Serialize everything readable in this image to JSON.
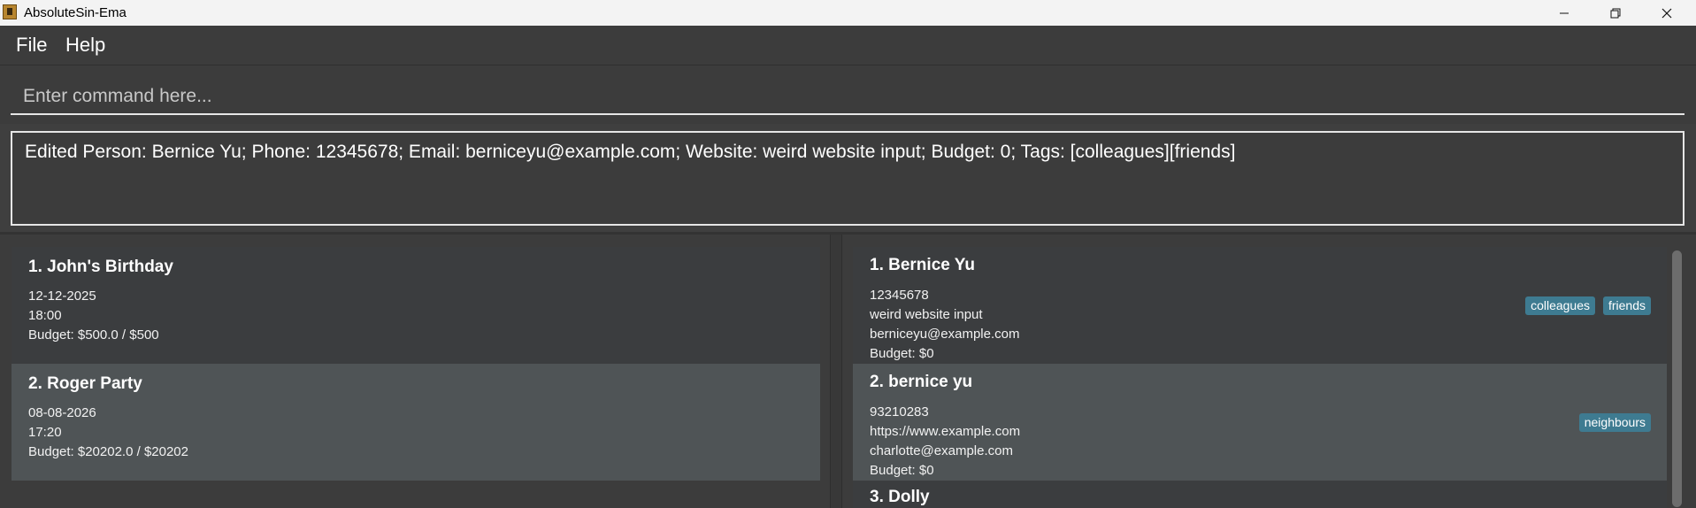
{
  "window": {
    "title": "AbsoluteSin-Ema",
    "minimize_icon": "minimize-icon",
    "restore_icon": "restore-icon",
    "close_icon": "close-icon"
  },
  "menu": {
    "file": "File",
    "help": "Help"
  },
  "command": {
    "placeholder": "Enter command here...",
    "value": ""
  },
  "result": {
    "text": "Edited Person: Bernice Yu; Phone: 12345678; Email: berniceyu@example.com; Website: weird website input; Budget: 0; Tags: [colleagues][friends]"
  },
  "events": [
    {
      "title": "1. John's Birthday",
      "date": "12-12-2025",
      "time": "18:00",
      "budget": "Budget: $500.0 / $500"
    },
    {
      "title": "2. Roger Party",
      "date": "08-08-2026",
      "time": "17:20",
      "budget": "Budget: $20202.0 / $20202"
    }
  ],
  "persons": [
    {
      "name": "1. Bernice Yu",
      "phone": "12345678",
      "website": "weird website input",
      "email": "berniceyu@example.com",
      "budget": "Budget: $0",
      "tags": [
        "colleagues",
        "friends"
      ]
    },
    {
      "name": "2. bernice yu",
      "phone": "93210283",
      "website": "https://www.example.com",
      "email": "charlotte@example.com",
      "budget": "Budget: $0",
      "tags": [
        "neighbours"
      ]
    },
    {
      "name": "3. Dolly"
    }
  ],
  "colors": {
    "background": "#3f3f3f",
    "card_dark": "#3b3d3f",
    "card_light": "#4f5456",
    "tag": "#3e7b91"
  }
}
